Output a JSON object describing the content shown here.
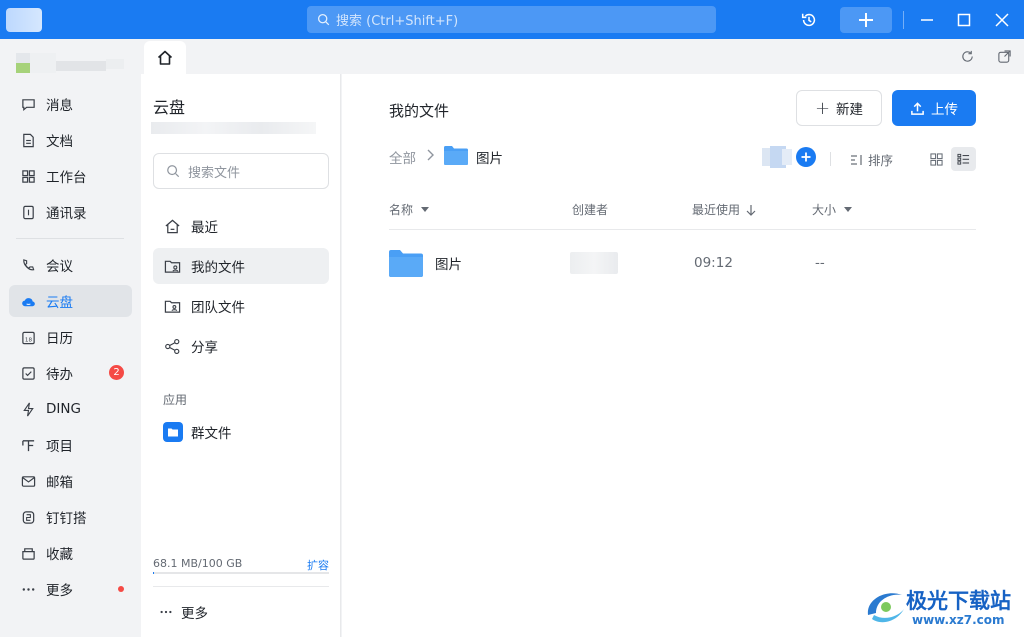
{
  "titlebar": {
    "search_placeholder": "搜索 (Ctrl+Shift+F)",
    "history_icon": "history-icon",
    "accent": "#1a7bf2"
  },
  "nav": {
    "items": [
      {
        "label": "消息",
        "icon": "message-icon"
      },
      {
        "label": "文档",
        "icon": "document-icon"
      },
      {
        "label": "工作台",
        "icon": "workbench-icon"
      },
      {
        "label": "通讯录",
        "icon": "contacts-icon"
      },
      {
        "label": "会议",
        "icon": "meeting-icon"
      },
      {
        "label": "云盘",
        "icon": "cloud-icon",
        "active": true
      },
      {
        "label": "日历",
        "icon": "calendar-icon"
      },
      {
        "label": "待办",
        "icon": "todo-icon",
        "badge": "2"
      },
      {
        "label": "DING",
        "icon": "ding-icon"
      },
      {
        "label": "项目",
        "icon": "project-icon"
      },
      {
        "label": "邮箱",
        "icon": "mail-icon"
      },
      {
        "label": "钉钉搭",
        "icon": "dingda-icon"
      },
      {
        "label": "收藏",
        "icon": "favorites-icon"
      },
      {
        "label": "更多",
        "icon": "more-icon",
        "dot": true
      }
    ]
  },
  "sidebar": {
    "title": "云盘",
    "search_placeholder": "搜索文件",
    "items": [
      {
        "label": "最近",
        "icon": "home-icon"
      },
      {
        "label": "我的文件",
        "icon": "my-files-icon",
        "active": true
      },
      {
        "label": "团队文件",
        "icon": "team-files-icon"
      },
      {
        "label": "分享",
        "icon": "share-icon"
      }
    ],
    "section_label": "应用",
    "app_item": "群文件",
    "quota_text": "68.1 MB/100 GB",
    "quota_fraction": 0.0007,
    "expand_label": "扩容",
    "more_label": "更多"
  },
  "main": {
    "title": "我的文件",
    "new_button": "新建",
    "upload_button": "上传",
    "breadcrumb_root": "全部",
    "breadcrumb_current": "图片",
    "sort_label": "排序",
    "columns": {
      "name": "名称",
      "creator": "创建者",
      "last_used": "最近使用",
      "size": "大小"
    },
    "rows": [
      {
        "name": "图片",
        "last_used": "09:12",
        "size": "--"
      }
    ]
  },
  "watermark": {
    "title": "极光下载站",
    "url": "www.xz7.com"
  }
}
